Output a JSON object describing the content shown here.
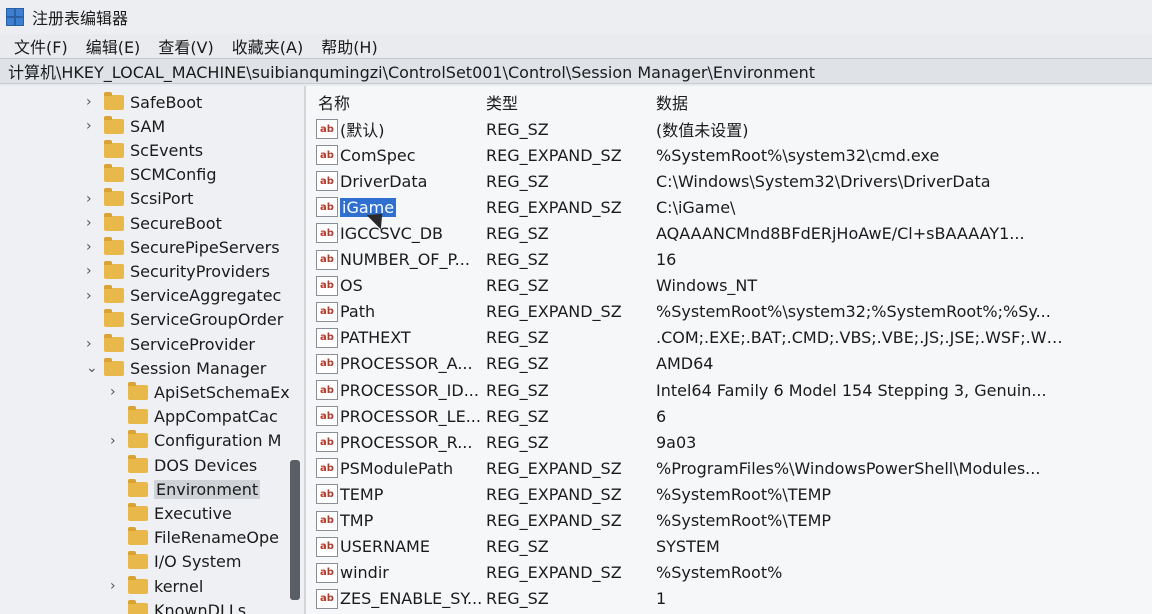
{
  "window": {
    "title": "注册表编辑器"
  },
  "menu": [
    "文件(F)",
    "编辑(E)",
    "查看(V)",
    "收藏夹(A)",
    "帮助(H)"
  ],
  "address": "计算机\\HKEY_LOCAL_MACHINE\\suibianqumingzi\\ControlSet001\\Control\\Session Manager\\Environment",
  "tree": [
    {
      "label": "SafeBoot",
      "indent": 1,
      "expander": true
    },
    {
      "label": "SAM",
      "indent": 1,
      "expander": true
    },
    {
      "label": "ScEvents",
      "indent": 1,
      "expander": false
    },
    {
      "label": "SCMConfig",
      "indent": 1,
      "expander": false
    },
    {
      "label": "ScsiPort",
      "indent": 1,
      "expander": true
    },
    {
      "label": "SecureBoot",
      "indent": 1,
      "expander": true
    },
    {
      "label": "SecurePipeServers",
      "indent": 1,
      "expander": true
    },
    {
      "label": "SecurityProviders",
      "indent": 1,
      "expander": true
    },
    {
      "label": "ServiceAggregatec",
      "indent": 1,
      "expander": true
    },
    {
      "label": "ServiceGroupOrder",
      "indent": 1,
      "expander": false
    },
    {
      "label": "ServiceProvider",
      "indent": 1,
      "expander": true
    },
    {
      "label": "Session Manager",
      "indent": 1,
      "expander": "open"
    },
    {
      "label": "ApiSetSchemaEx",
      "indent": 2,
      "expander": true
    },
    {
      "label": "AppCompatCac",
      "indent": 2,
      "expander": false
    },
    {
      "label": "Configuration M",
      "indent": 2,
      "expander": true
    },
    {
      "label": "DOS Devices",
      "indent": 2,
      "expander": false
    },
    {
      "label": "Environment",
      "indent": 2,
      "expander": false,
      "selected": true
    },
    {
      "label": "Executive",
      "indent": 2,
      "expander": false
    },
    {
      "label": "FileRenameOpe",
      "indent": 2,
      "expander": false
    },
    {
      "label": "I/O System",
      "indent": 2,
      "expander": false
    },
    {
      "label": "kernel",
      "indent": 2,
      "expander": true
    },
    {
      "label": "KnownDLLs",
      "indent": 2,
      "expander": false
    }
  ],
  "columns": {
    "name": "名称",
    "type": "类型",
    "data": "数据"
  },
  "rows": [
    {
      "name": "(默认)",
      "type": "REG_SZ",
      "data": "(数值未设置)"
    },
    {
      "name": "ComSpec",
      "type": "REG_EXPAND_SZ",
      "data": "%SystemRoot%\\system32\\cmd.exe"
    },
    {
      "name": "DriverData",
      "type": "REG_SZ",
      "data": "C:\\Windows\\System32\\Drivers\\DriverData"
    },
    {
      "name": "iGame",
      "type": "REG_EXPAND_SZ",
      "data": "C:\\iGame\\",
      "selected": true
    },
    {
      "name": "IGCCSVC_DB",
      "type": "REG_SZ",
      "data": "AQAAANCMnd8BFdERjHoAwE/Cl+sBAAAAY1..."
    },
    {
      "name": "NUMBER_OF_P...",
      "type": "REG_SZ",
      "data": "16"
    },
    {
      "name": "OS",
      "type": "REG_SZ",
      "data": "Windows_NT"
    },
    {
      "name": "Path",
      "type": "REG_EXPAND_SZ",
      "data": "%SystemRoot%\\system32;%SystemRoot%;%Sy..."
    },
    {
      "name": "PATHEXT",
      "type": "REG_SZ",
      "data": ".COM;.EXE;.BAT;.CMD;.VBS;.VBE;.JS;.JSE;.WSF;.WS..."
    },
    {
      "name": "PROCESSOR_A...",
      "type": "REG_SZ",
      "data": "AMD64"
    },
    {
      "name": "PROCESSOR_ID...",
      "type": "REG_SZ",
      "data": "Intel64 Family 6 Model 154 Stepping 3, Genuin..."
    },
    {
      "name": "PROCESSOR_LE...",
      "type": "REG_SZ",
      "data": "6"
    },
    {
      "name": "PROCESSOR_R...",
      "type": "REG_SZ",
      "data": "9a03"
    },
    {
      "name": "PSModulePath",
      "type": "REG_EXPAND_SZ",
      "data": "%ProgramFiles%\\WindowsPowerShell\\Modules..."
    },
    {
      "name": "TEMP",
      "type": "REG_EXPAND_SZ",
      "data": "%SystemRoot%\\TEMP"
    },
    {
      "name": "TMP",
      "type": "REG_EXPAND_SZ",
      "data": "%SystemRoot%\\TEMP"
    },
    {
      "name": "USERNAME",
      "type": "REG_SZ",
      "data": "SYSTEM"
    },
    {
      "name": "windir",
      "type": "REG_EXPAND_SZ",
      "data": "%SystemRoot%"
    },
    {
      "name": "ZES_ENABLE_SY...",
      "type": "REG_SZ",
      "data": "1"
    }
  ],
  "icons": {
    "value": "string-value-icon",
    "folder": "folder-icon",
    "app": "registry-editor-icon"
  }
}
